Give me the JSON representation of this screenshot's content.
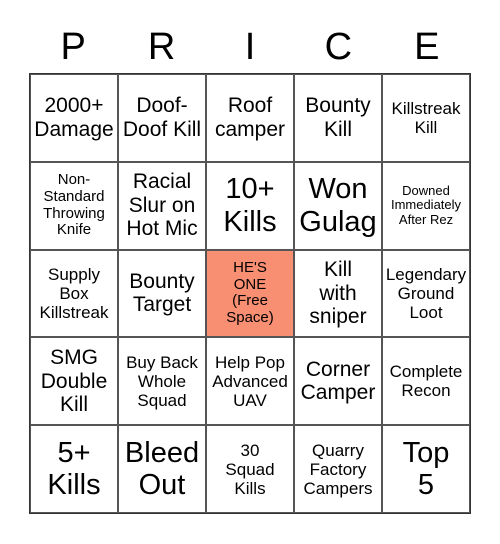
{
  "header": {
    "letters": [
      "P",
      "R",
      "I",
      "C",
      "E"
    ]
  },
  "free_space_color": "#f98f72",
  "board": {
    "rows": [
      [
        "2000+ Damage",
        "Doof-Doof Kill",
        "Roof camper",
        "Bounty Kill",
        "Killstreak Kill"
      ],
      [
        "Non-Standard Throwing Knife",
        "Racial Slur on Hot Mic",
        "10+ Kills",
        "Won Gulag",
        "Downed Immediately After Rez"
      ],
      [
        "Supply Box Killstreak",
        "Bounty Target",
        "HE'S ONE (Free Space)",
        "Kill with sniper",
        "Legendary Ground Loot"
      ],
      [
        "SMG Double Kill",
        "Buy Back Whole Squad",
        "Help Pop Advanced UAV",
        "Corner Camper",
        "Complete Recon"
      ],
      [
        "5+ Kills",
        "Bleed Out",
        "30 Squad Kills",
        "Quarry Factory Campers",
        "Top 5"
      ]
    ]
  }
}
